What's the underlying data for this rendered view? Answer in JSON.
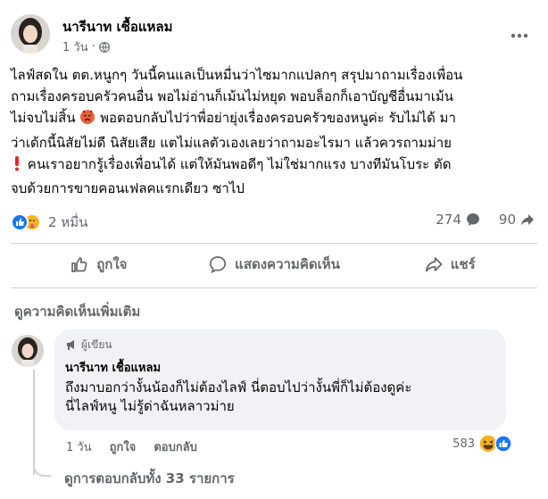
{
  "post": {
    "author": "นารีนาท เชื้อแหลม",
    "time": "1 วัน",
    "privacy_icon": "globe-icon",
    "more_icon": "more-dots-icon",
    "lines": [
      "ไลฟ์สดใน ตต.หนูกๆ วันนี้คนแลเป็นหมื่นว่าไซมากแปลกๆ สรุปมาถามเรื่องเพื่อน",
      "ถามเรื่องครอบครัวคนอื่น พอไม่อ่านก็เม้นไม่หยุด พอบล็อกก็เอาบัญชีอื่นมาเม้น",
      "ไม่จบไม่สิ้น",
      "พอตอบกลับไปว่าพื่อย่ายุ่งเรื่องครอบครัวของหนูค่ะ รับไม่ได้ มา",
      "ว่าเด้กนี้นิสัยไม่ดี นิสัยเสีย แตไม่แลตัวเองเลยว่าถามอะไรมา แล้วควรถามม่าย",
      "คนเราอยากรู้เรื่องเพื่อนได้ แต่ให้มันพอดีๆ ไม่ใช่มากแรง บางทีมันโบระ ตัด",
      "จบด้วยการขายคอนเฟลคแรกเดียว ซาไป"
    ]
  },
  "stats": {
    "reactions_count": "2 หมื่น",
    "comments_count": "274",
    "shares_count": "90",
    "reaction_types": [
      "like",
      "care"
    ]
  },
  "actions": {
    "like": "ถูกใจ",
    "comment": "แสดงความคิดเห็น",
    "share": "แชร์"
  },
  "comments_section": {
    "more_comments": "ดูความคิดเห็นเพิ่มเติม",
    "comment": {
      "badge": "ผู้เขียน",
      "author": "นารีนาท เชื้อแหลม",
      "lines": [
        "ถึงมาบอกว่างั้นน้องก็ไม่ต้องไลฟ์ นี่ตอบไปว่างั้นพี่ก็ไม่ต้องดูค่ะ",
        "นี่ไลฟ์หนู ไม่รู้ด่าฉันหลาวม่าย"
      ],
      "time": "1 วัน",
      "like": "ถูกใจ",
      "reply": "ตอบกลับ",
      "reaction_count": "583"
    },
    "view_replies": "ดูการตอบกลับทั้ง 33 รายการ"
  },
  "colors": {
    "accent": "#1877f2",
    "secondary_text": "#65676b",
    "bubble_bg": "#f0f2f5",
    "care_yellow": "#f7b125",
    "alert_red": "#e02828"
  }
}
